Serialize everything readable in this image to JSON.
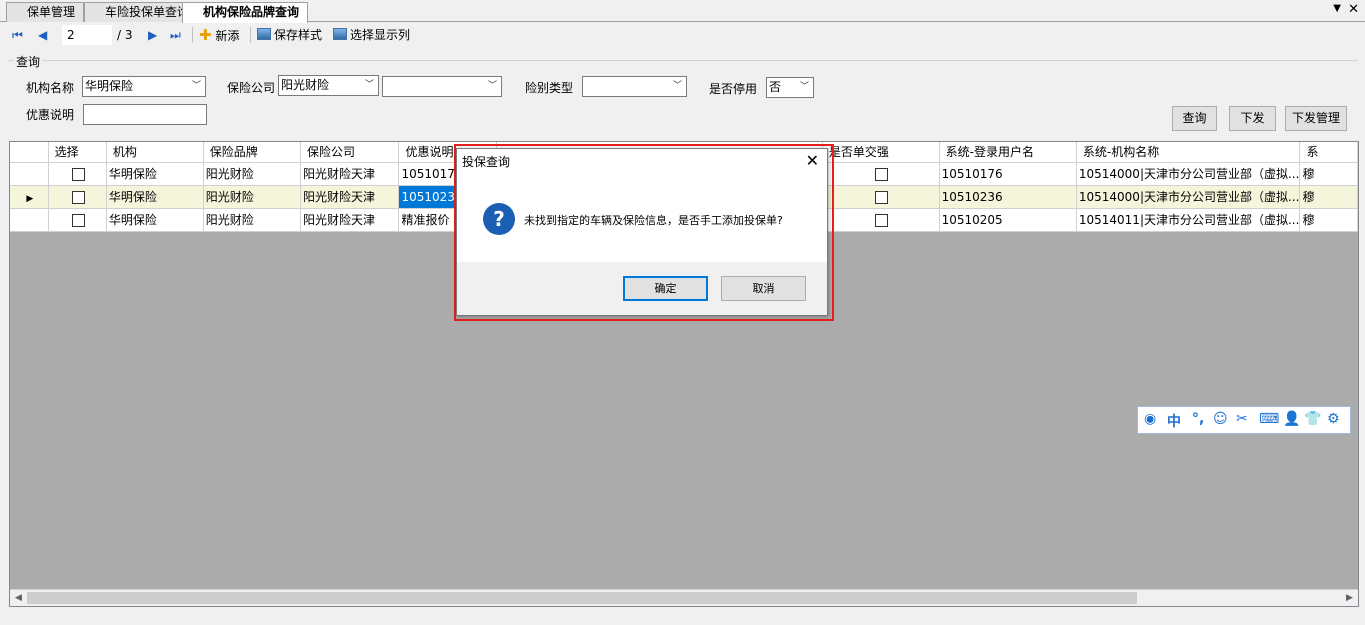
{
  "tabs": [
    "保单管理",
    "车险投保单查询",
    "机构保险品牌查询"
  ],
  "toolbar": {
    "page_current": "2",
    "page_total": "/ 3",
    "new_label": "新添",
    "save_style_label": "保存样式",
    "select_columns_label": "选择显示列"
  },
  "query": {
    "group_title": "查询",
    "org_name_label": "机构名称",
    "org_name_value": "华明保险",
    "insurer_label": "保险公司",
    "insurer_value": "阳光财险",
    "insurer_sub_value": "",
    "risk_type_label": "险别类型",
    "risk_type_value": "",
    "disabled_label": "是否停用",
    "disabled_value": "否",
    "discount_label": "优惠说明",
    "discount_value": "",
    "search_btn": "查询",
    "issue_btn": "下发",
    "issue_mgmt_btn": "下发管理"
  },
  "grid": {
    "columns": [
      "选择",
      "机构",
      "保险品牌",
      "保险公司",
      "优惠说明",
      "",
      "是否单交强",
      "系统-登录用户名",
      "系统-机构名称",
      "系"
    ],
    "rows": [
      {
        "org": "华明保险",
        "brand": "阳光财险",
        "company": "阳光财险天津",
        "discount": "1051017",
        "user": "10510176",
        "orgname": "10514000|天津市分公司营业部（虚拟...",
        "extra": "穆"
      },
      {
        "org": "华明保险",
        "brand": "阳光财险",
        "company": "阳光财险天津",
        "discount": "1051023",
        "user": "10510236",
        "orgname": "10514000|天津市分公司营业部（虚拟...",
        "extra": "穆"
      },
      {
        "org": "华明保险",
        "brand": "阳光财险",
        "company": "阳光财险天津",
        "discount": "精准报价",
        "user": "10510205",
        "orgname": "10514011|天津市分公司营业部（虚拟...",
        "extra": "穆"
      }
    ]
  },
  "ime": {
    "mode": "中"
  },
  "dialog": {
    "title": "投保查询",
    "message": "未找到指定的车辆及保险信息，是否手工添加投保单?",
    "ok": "确定",
    "cancel": "取消"
  }
}
